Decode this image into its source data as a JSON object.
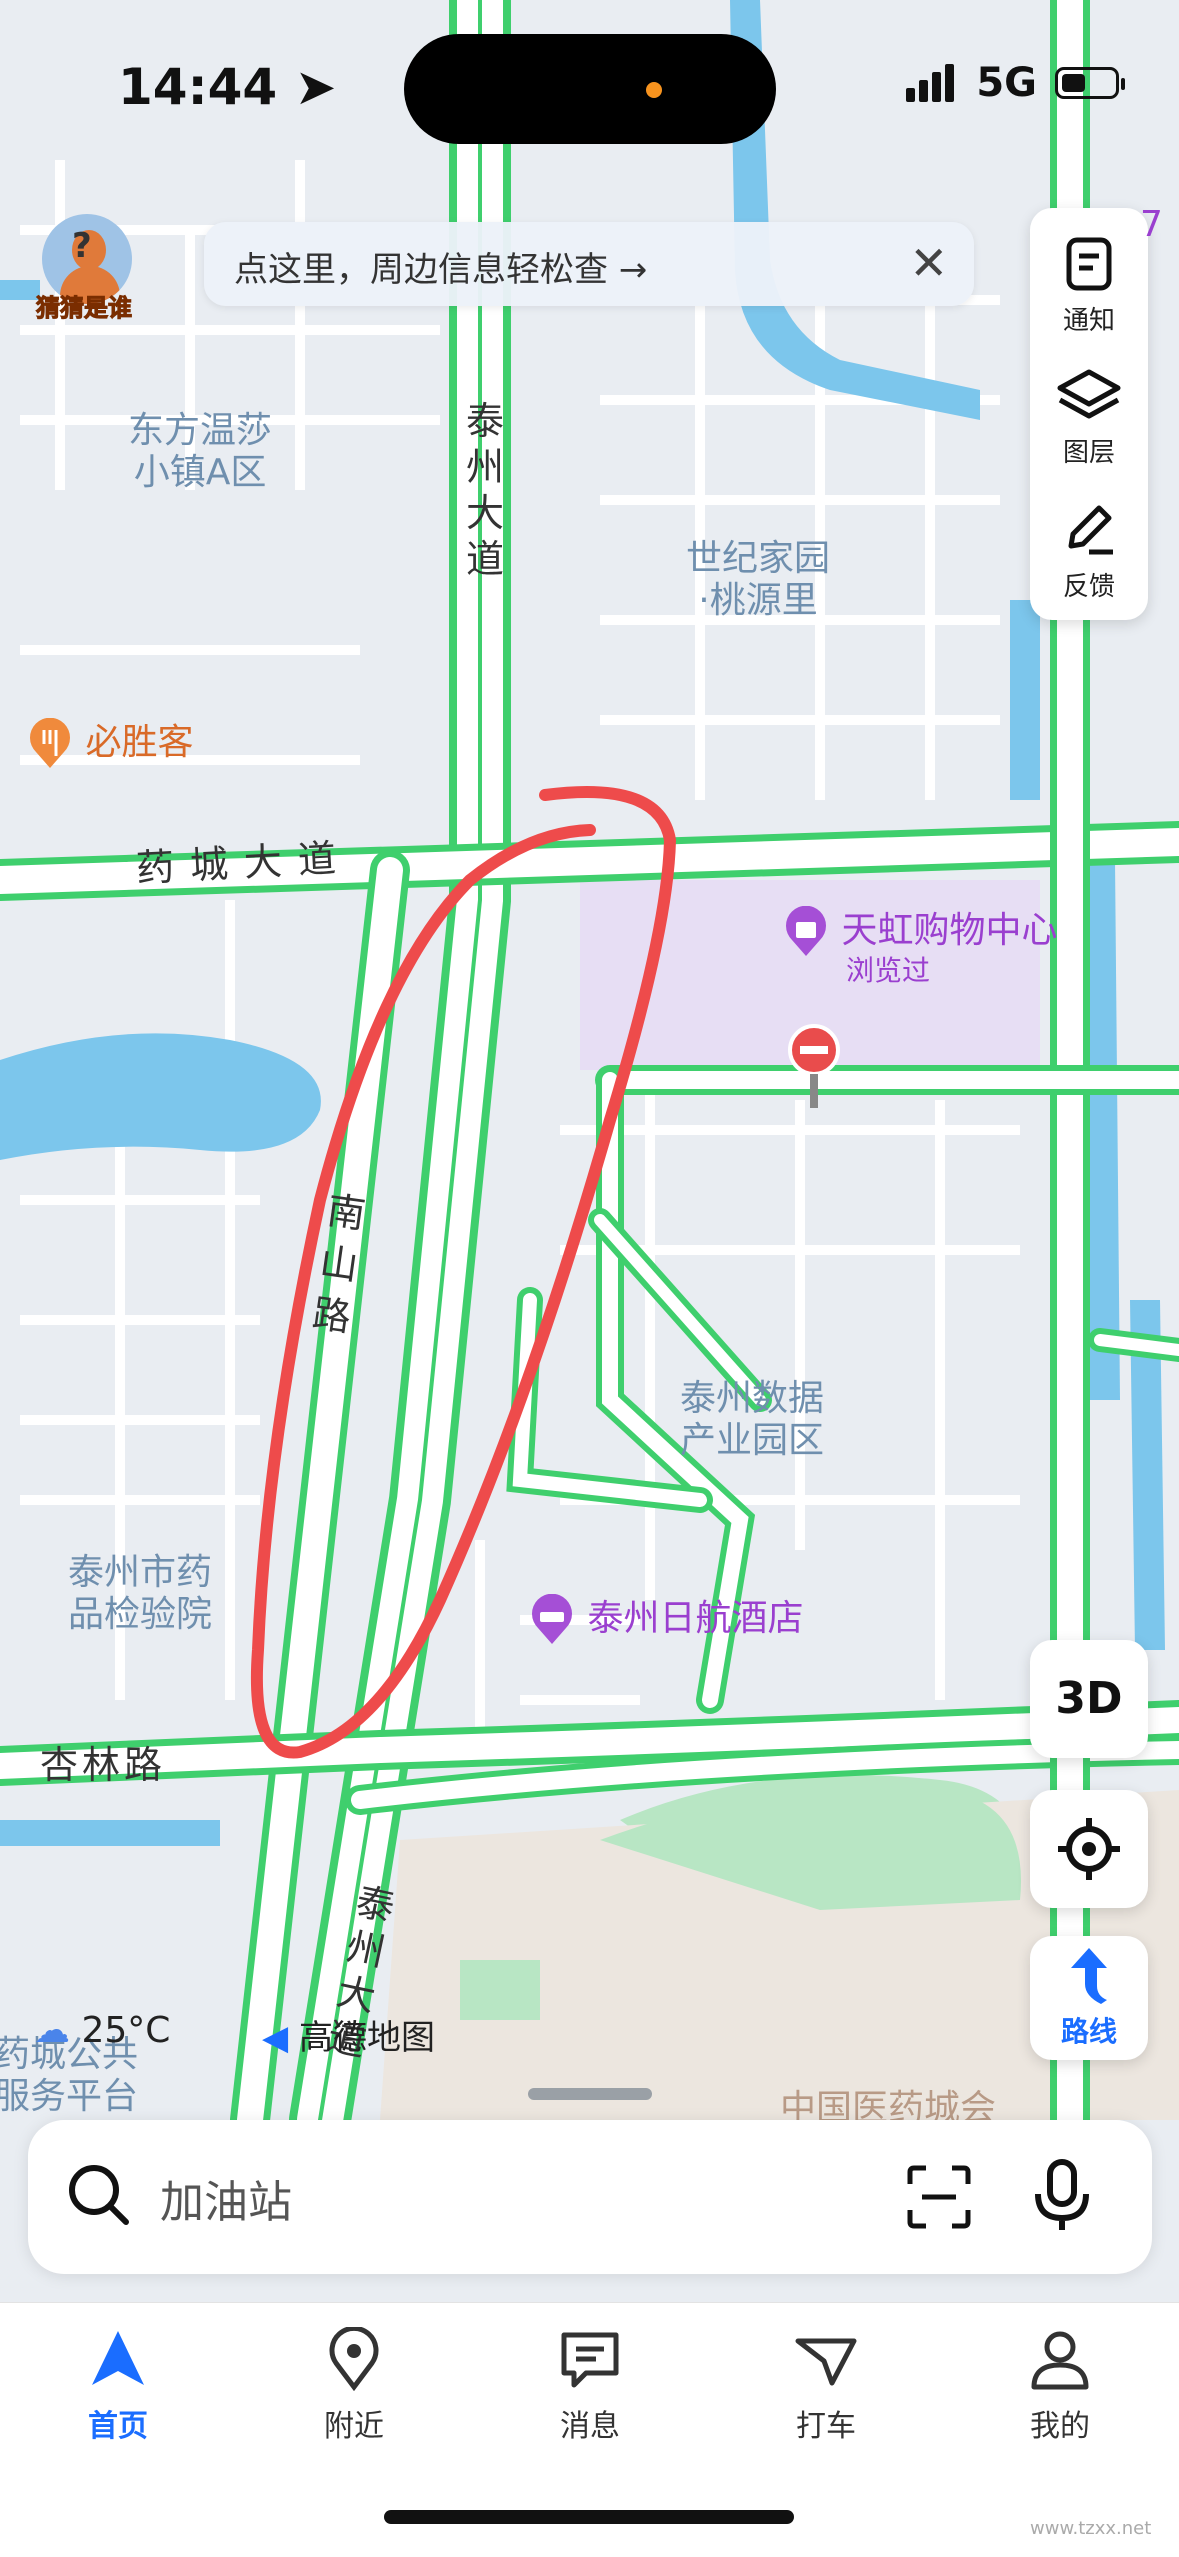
{
  "status_bar": {
    "time": "14:44",
    "network": "5G",
    "battery_level": 0.45
  },
  "avatar": {
    "label": "猜猜是谁"
  },
  "banner": {
    "text": "点这里，周边信息轻松查 →",
    "close": "✕"
  },
  "side_tools": [
    {
      "icon": "notification-icon",
      "label": "通知"
    },
    {
      "icon": "layers-icon",
      "label": "图层"
    },
    {
      "icon": "feedback-icon",
      "label": "反馈"
    }
  ],
  "map": {
    "roads": {
      "taizhou_avenue_north": "泰州大道",
      "taizhou_avenue_south": "泰州大道",
      "yaocheng_avenue": "药城大道",
      "nanshan_road": "南山路",
      "xinglin_road": "杏林路"
    },
    "areas": {
      "dongfang": "东方温莎\n小镇A区",
      "shiji": "世纪家园\n·桃源里",
      "data_park": "泰州数据\n产业园区",
      "drug_inspection": "泰州市药\n品检验院",
      "public_service": "药城公共\n服务平台",
      "medicine_city": "中国医药城会"
    },
    "pois": {
      "bishengke": "必胜客",
      "tianhong": "天虹购物中心",
      "tianhong_sub": "浏览过",
      "hotel": "泰州日航酒店"
    },
    "edge_marker": "7"
  },
  "controls": {
    "three_d": "3D",
    "route": "路线"
  },
  "weather": {
    "temp": "25°C"
  },
  "brand": {
    "name": "高德地图"
  },
  "search": {
    "placeholder": "加油站"
  },
  "tabs": [
    {
      "label": "首页",
      "active": true
    },
    {
      "label": "附近",
      "active": false
    },
    {
      "label": "消息",
      "active": false
    },
    {
      "label": "打车",
      "active": false
    },
    {
      "label": "我的",
      "active": false
    }
  ],
  "colors": {
    "road_green": "#3fcf6d",
    "annotation_red": "#ee4b4b",
    "accent_blue": "#1a6dff",
    "water": "#7cc6ec"
  },
  "watermark": "www.tzxx.net"
}
